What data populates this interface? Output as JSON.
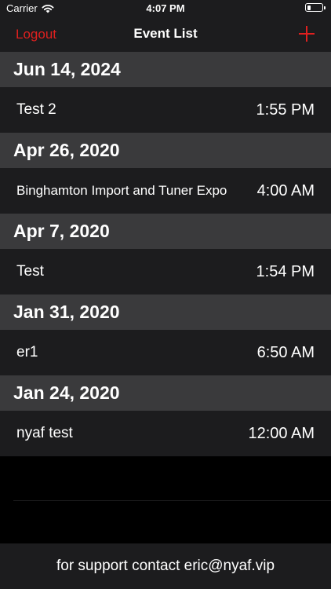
{
  "status_bar": {
    "carrier": "Carrier",
    "time": "4:07 PM",
    "wifi_icon": "wifi-icon",
    "battery_icon": "battery-icon"
  },
  "nav": {
    "left_label": "Logout",
    "title": "Event List",
    "add_icon": "plus-icon",
    "accent_color": "#e0201f"
  },
  "sections": [
    {
      "date": "Jun 14, 2024",
      "events": [
        {
          "title": "Test 2",
          "time": "1:55 PM"
        }
      ]
    },
    {
      "date": "Apr 26, 2020",
      "events": [
        {
          "title": "Binghamton Import and Tuner Expo",
          "time": "4:00 AM"
        }
      ]
    },
    {
      "date": "Apr 7, 2020",
      "events": [
        {
          "title": "Test",
          "time": "1:54 PM"
        }
      ]
    },
    {
      "date": "Jan 31, 2020",
      "events": [
        {
          "title": "er1",
          "time": "6:50 AM"
        }
      ]
    },
    {
      "date": "Jan 24, 2020",
      "events": [
        {
          "title": "nyaf test",
          "time": "12:00 AM"
        }
      ]
    }
  ],
  "footer": {
    "text": "for support contact eric@nyaf.vip"
  }
}
